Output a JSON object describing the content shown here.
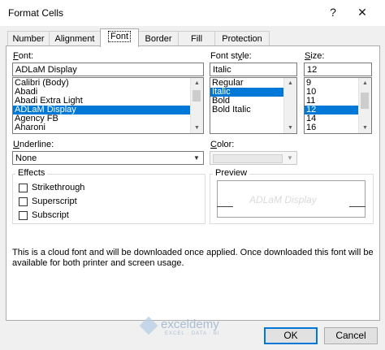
{
  "window": {
    "title": "Format Cells",
    "help": "?",
    "close": "✕"
  },
  "tabs": [
    "Number",
    "Alignment",
    "Font",
    "Border",
    "Fill",
    "Protection"
  ],
  "font": {
    "label": "Font:",
    "value": "ADLaM Display",
    "items": [
      "Calibri (Body)",
      "Abadi",
      "Abadi Extra Light",
      "ADLaM Display",
      "Agency FB",
      "Aharoni"
    ]
  },
  "style": {
    "label": "Font style:",
    "value": "Italic",
    "items": [
      "Regular",
      "Italic",
      "Bold",
      "Bold Italic"
    ]
  },
  "size": {
    "label": "Size:",
    "value": "12",
    "items": [
      "9",
      "10",
      "11",
      "12",
      "14",
      "16"
    ]
  },
  "underline": {
    "label": "Underline:",
    "value": "None"
  },
  "color": {
    "label": "Color:"
  },
  "effects": {
    "title": "Effects",
    "strikethrough": "Strikethrough",
    "superscript": "Superscript",
    "subscript": "Subscript"
  },
  "preview": {
    "title": "Preview",
    "text": "ADLaM Display"
  },
  "info": "This is a cloud font and will be downloaded once applied. Once downloaded this font will be available for both printer and screen usage.",
  "watermark": {
    "name": "exceldemy",
    "tagline": "EXCEL · DATA · BI"
  },
  "buttons": {
    "ok": "OK",
    "cancel": "Cancel"
  },
  "colors": {
    "selection": "#0078d7",
    "dialog": "#f0f0f0"
  }
}
